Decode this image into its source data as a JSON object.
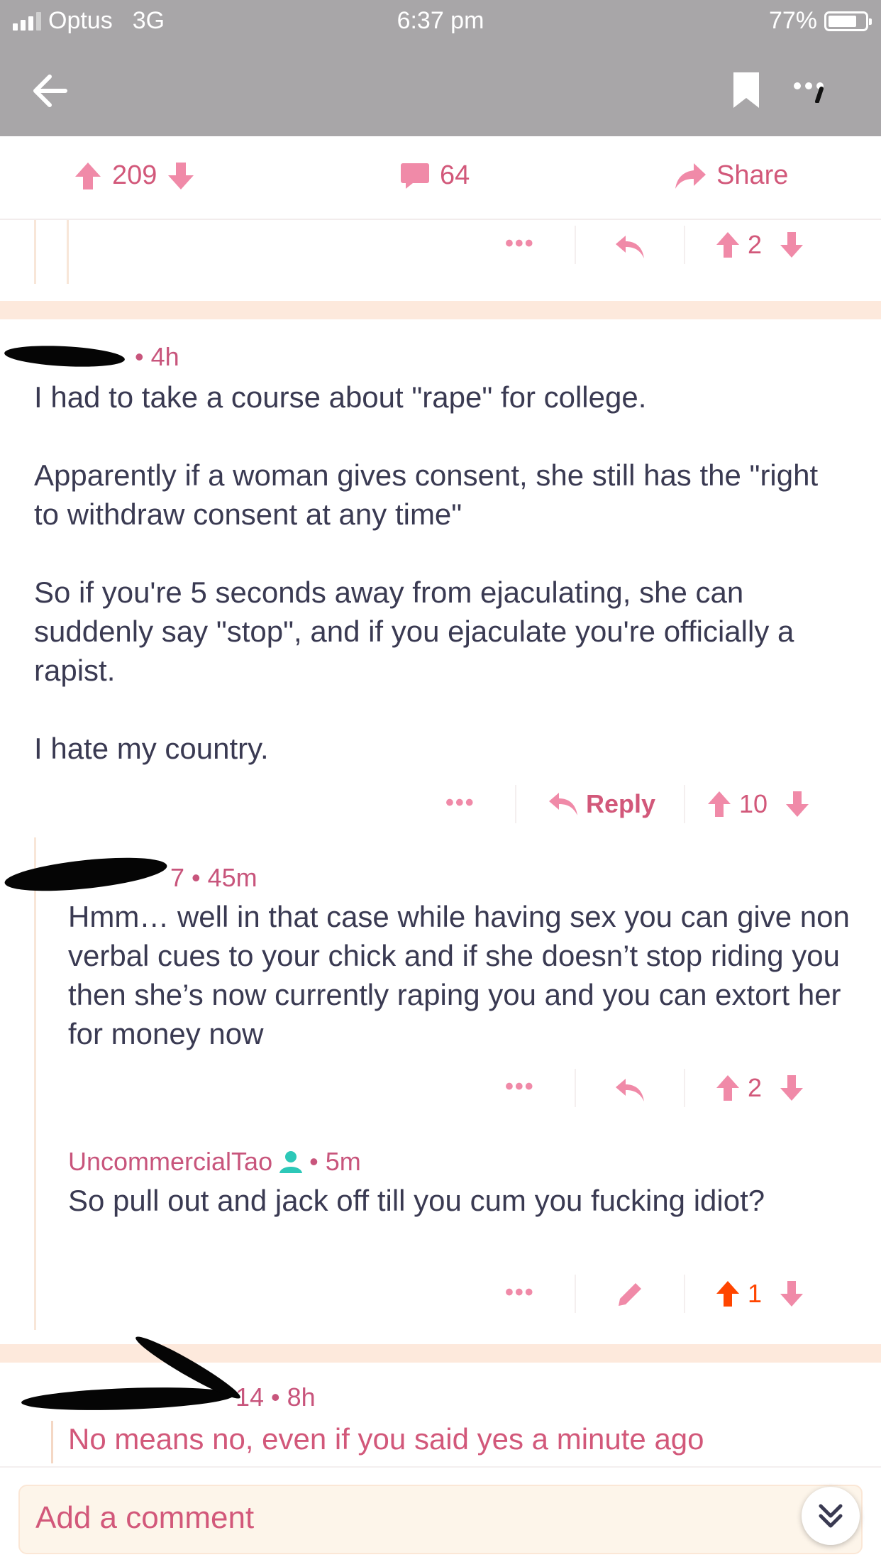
{
  "status": {
    "carrier": "Optus",
    "network": "3G",
    "time": "6:37 pm",
    "battery": "77%",
    "battery_level": 0.77
  },
  "post_actions": {
    "score": "209",
    "comments": "64",
    "share_label": "Share"
  },
  "thread": {
    "top_stub": {
      "score": "2"
    },
    "comment1": {
      "time": "• 4h",
      "body": "I had to take a course about \"rape\" for college.\n\nApparently if a woman gives consent, she still has the \"right to withdraw consent at any time\"\n\nSo if you're 5 seconds away from ejaculating, she can suddenly say \"stop\", and if you ejaculate you're officially a rapist.\n\nI hate my country.",
      "reply_label": "Reply",
      "score": "10"
    },
    "reply1": {
      "time": "7 • 45m",
      "body": "Hmm… well in that case while having sex you can give non verbal cues to your chick and if she doesn’t stop riding you then she’s now currently raping you and you can extort her for money now",
      "score": "2"
    },
    "reply2": {
      "username": "UncommercialTao",
      "time": "• 5m",
      "body": "So pull out and jack off till you cum you fucking idiot?",
      "score": "1",
      "upvoted_color": "#ff4500"
    },
    "comment2": {
      "time": "14 • 8h",
      "body": "No means no, even if you said yes a minute ago"
    }
  },
  "composer": {
    "placeholder": "Add a comment"
  },
  "colors": {
    "accent": "#d2587a",
    "icon_pink": "#f08aa8",
    "header_gray": "#a8a6a8",
    "divider": "#fde9dc"
  }
}
